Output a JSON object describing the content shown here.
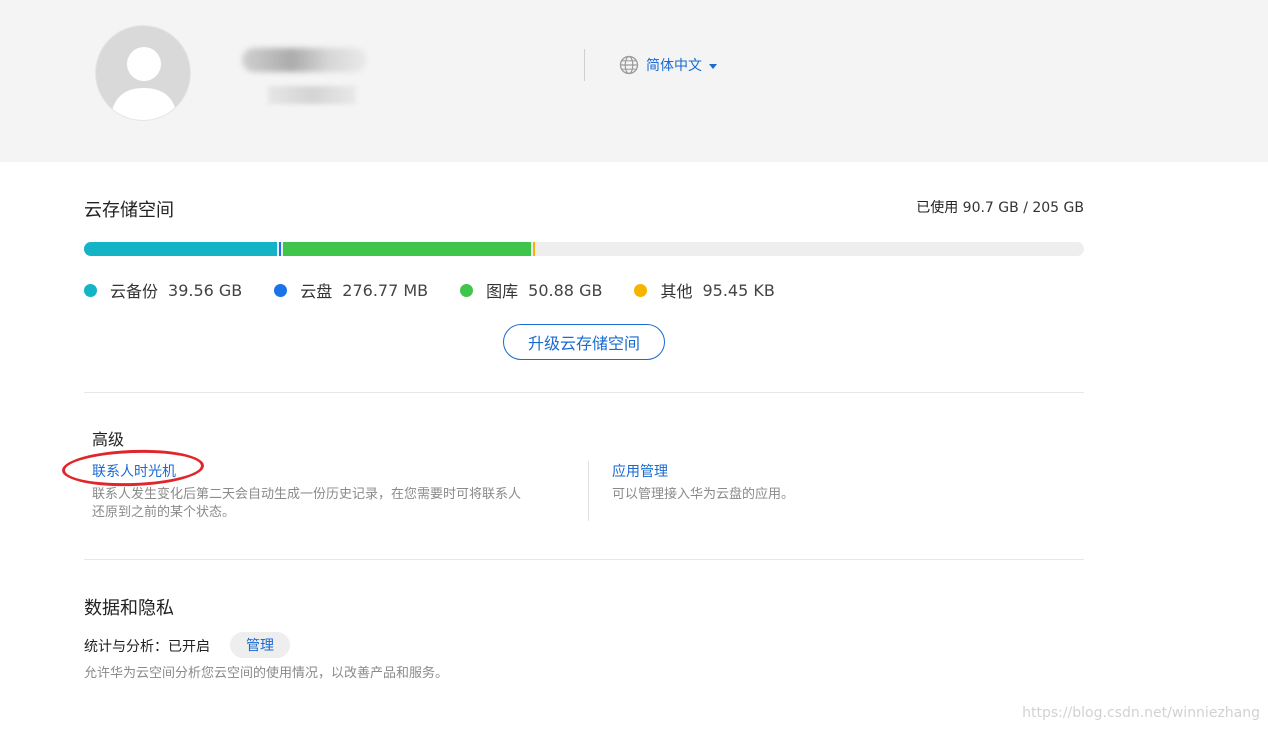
{
  "header": {
    "language": "简体中文"
  },
  "storage": {
    "title": "云存储空间",
    "used_label": "已使用",
    "used_value": "90.7 GB / 205 GB",
    "upgrade_label": "升级云存储空间",
    "segments": [
      {
        "name": "云备份",
        "amount": "39.56 GB",
        "color": "#14b3c6",
        "fraction": 0.193
      },
      {
        "name": "云盘",
        "amount": "276.77 MB",
        "color": "#1a73e8",
        "fraction": 0.0013
      },
      {
        "name": "图库",
        "amount": "50.88 GB",
        "color": "#3fc44c",
        "fraction": 0.248
      },
      {
        "name": "其他",
        "amount": "95.45 KB",
        "color": "#f5b400",
        "fraction": 0.0005
      }
    ]
  },
  "advanced": {
    "title": "高级",
    "cards": [
      {
        "link": "联系人时光机",
        "desc_line1": "联系人发生变化后第二天会自动生成一份历史记录，在您需要时可将联系人",
        "desc_line2": "还原到之前的某个状态。"
      },
      {
        "link": "应用管理",
        "desc_line1": "可以管理接入华为云盘的应用。"
      }
    ]
  },
  "privacy": {
    "title": "数据和隐私",
    "stat_label": "统计与分析：已开启",
    "manage_label": "管理",
    "desc": "允许华为云空间分析您云空间的使用情况，以改善产品和服务。"
  },
  "watermark": "https://blog.csdn.net/winniezhang"
}
